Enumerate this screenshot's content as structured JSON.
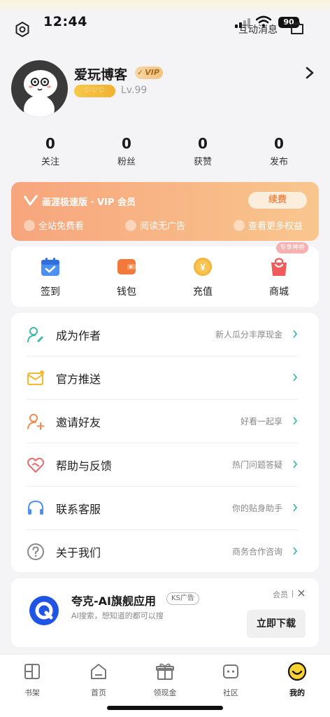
{
  "status_bar": {
    "time": "12:44",
    "battery": "90"
  },
  "header": {
    "messages_label": "互动消息"
  },
  "profile": {
    "username": "爱玩博客",
    "vip_badge": "VIP",
    "hearts": "♡♡♡",
    "level": "Lv.99"
  },
  "stats": [
    {
      "value": "0",
      "label": "关注"
    },
    {
      "value": "0",
      "label": "粉丝"
    },
    {
      "value": "0",
      "label": "获赞"
    },
    {
      "value": "0",
      "label": "发布"
    }
  ],
  "vip_card": {
    "title": "画涯极速版 · VIP 会员",
    "renew_label": "续费",
    "benefits": [
      "全站免费看",
      "阅读无广告",
      "查看更多权益"
    ]
  },
  "quick_actions": [
    {
      "label": "签到",
      "icon": "calendar-check-icon"
    },
    {
      "label": "钱包",
      "icon": "wallet-icon"
    },
    {
      "label": "充值",
      "icon": "yen-coin-icon"
    },
    {
      "label": "商城",
      "icon": "shopping-bag-icon"
    }
  ],
  "quick_tag": "专享神券",
  "menu": [
    {
      "title": "成为作者",
      "sub": "新人瓜分丰厚现金",
      "icon": "author-pen-icon"
    },
    {
      "title": "官方推送",
      "sub": "",
      "icon": "mail-icon"
    },
    {
      "title": "邀请好友",
      "sub": "好看一起享",
      "icon": "add-friend-icon"
    },
    {
      "title": "帮助与反馈",
      "sub": "热门问题答疑",
      "icon": "heart-help-icon"
    },
    {
      "title": "联系客服",
      "sub": "你的贴身助手",
      "icon": "headset-icon"
    },
    {
      "title": "关于我们",
      "sub": "商务合作咨询",
      "icon": "question-icon"
    }
  ],
  "ad": {
    "title": "夸克-AI旗舰应用",
    "tag": "KS广告",
    "desc": "AI搜索，想知道的都可以搜",
    "member": "会员",
    "cta": "立即下载"
  },
  "tabs": [
    {
      "label": "书架",
      "icon": "bookshelf-icon"
    },
    {
      "label": "首页",
      "icon": "home-icon"
    },
    {
      "label": "领现金",
      "icon": "gift-icon"
    },
    {
      "label": "社区",
      "icon": "community-icon"
    },
    {
      "label": "我的",
      "icon": "smiley-icon"
    }
  ],
  "colors": {
    "accent": "#f08b4d",
    "vip_gradient_start": "#f7a57c",
    "vip_gradient_end": "#f9c68e",
    "teal": "#3fb8a7"
  }
}
